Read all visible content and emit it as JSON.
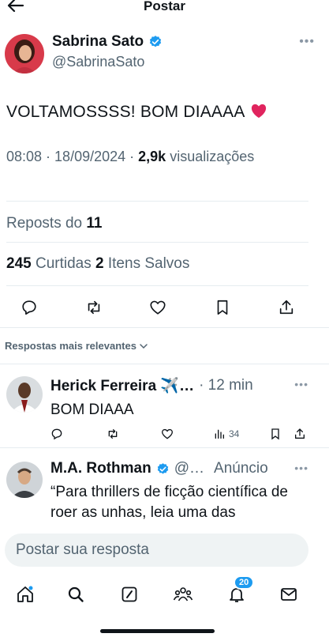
{
  "header": {
    "title": "Postar"
  },
  "post": {
    "author_name": "Sabrina Sato",
    "author_handle": "@SabrinaSato",
    "text": "VOLTAMOSSSS! BOM DIAAAA",
    "time": "08:08",
    "date": "18/09/2024",
    "views_count": "2,9k",
    "views_label": "visualizações",
    "reposts_label": "Reposts do",
    "reposts_count": "11",
    "likes_count": "245",
    "likes_label": "Curtidas",
    "saves_count": "2",
    "saves_label": "Itens Salvos"
  },
  "sort": {
    "label": "Respostas mais relevantes"
  },
  "replies": [
    {
      "name": "Herick Ferreira ✈️…",
      "sub": "· 12 min",
      "text": "BOM DIAAA",
      "views": "34"
    },
    {
      "name": "M.A. Rothman",
      "sub": "@…",
      "tag": "Anúncio",
      "text": "“Para thrillers de ficção científica de roer as unhas, leia uma das"
    }
  ],
  "compose": {
    "placeholder": "Postar sua resposta"
  },
  "tabbar": {
    "notifications_badge": "20"
  },
  "colors": {
    "accent": "#1d9bf0",
    "text": "#0f1419",
    "muted": "#536471",
    "heart": "#e0245e"
  },
  "icons": [
    "back-arrow-icon",
    "verified-badge-icon",
    "more-icon",
    "reply-icon",
    "repost-icon",
    "like-icon",
    "bookmark-icon",
    "share-icon",
    "views-icon",
    "home-icon",
    "search-icon",
    "grok-icon",
    "communities-icon",
    "notifications-icon",
    "messages-icon"
  ]
}
